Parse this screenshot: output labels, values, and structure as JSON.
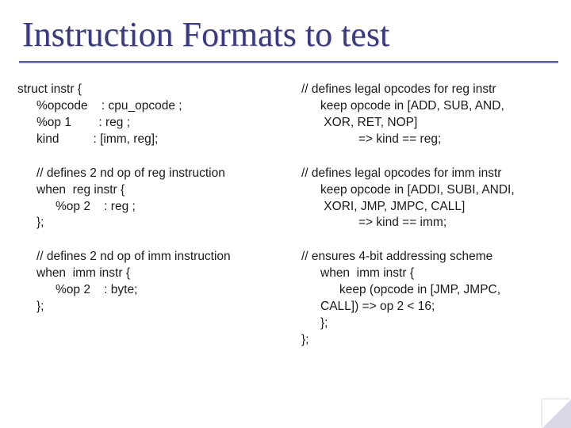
{
  "title": "Instruction Formats to test",
  "left": {
    "b1": {
      "l1": "struct instr {",
      "l2": "%opcode    : cpu_opcode ;",
      "l3": "%op 1        : reg ;",
      "l4": "kind          : [imm, reg];"
    },
    "b2": {
      "l1": "// defines 2 nd op of reg instruction",
      "l2": "when  reg instr {",
      "l3": "%op 2    : reg ;",
      "l4": "};"
    },
    "b3": {
      "l1": "// defines 2 nd op of imm instruction",
      "l2": "when  imm instr {",
      "l3": "%op 2    : byte;",
      "l4": "};"
    }
  },
  "right": {
    "b1": {
      "l1": "// defines legal opcodes for reg instr",
      "l2": "keep opcode in [ADD, SUB, AND,",
      "l3": " XOR, RET, NOP]",
      "l4": "=> kind == reg;"
    },
    "b2": {
      "l1": "// defines legal opcodes for imm instr",
      "l2": "keep opcode in [ADDI, SUBI, ANDI,",
      "l3": " XORI, JMP, JMPC, CALL]",
      "l4": "=> kind == imm;"
    },
    "b3": {
      "l1": "// ensures 4-bit addressing scheme",
      "l2": "when  imm instr {",
      "l3": "keep (opcode in [JMP, JMPC,",
      "l4": "CALL]) => op 2 < 16;",
      "l5": "};",
      "l6": "};"
    }
  }
}
